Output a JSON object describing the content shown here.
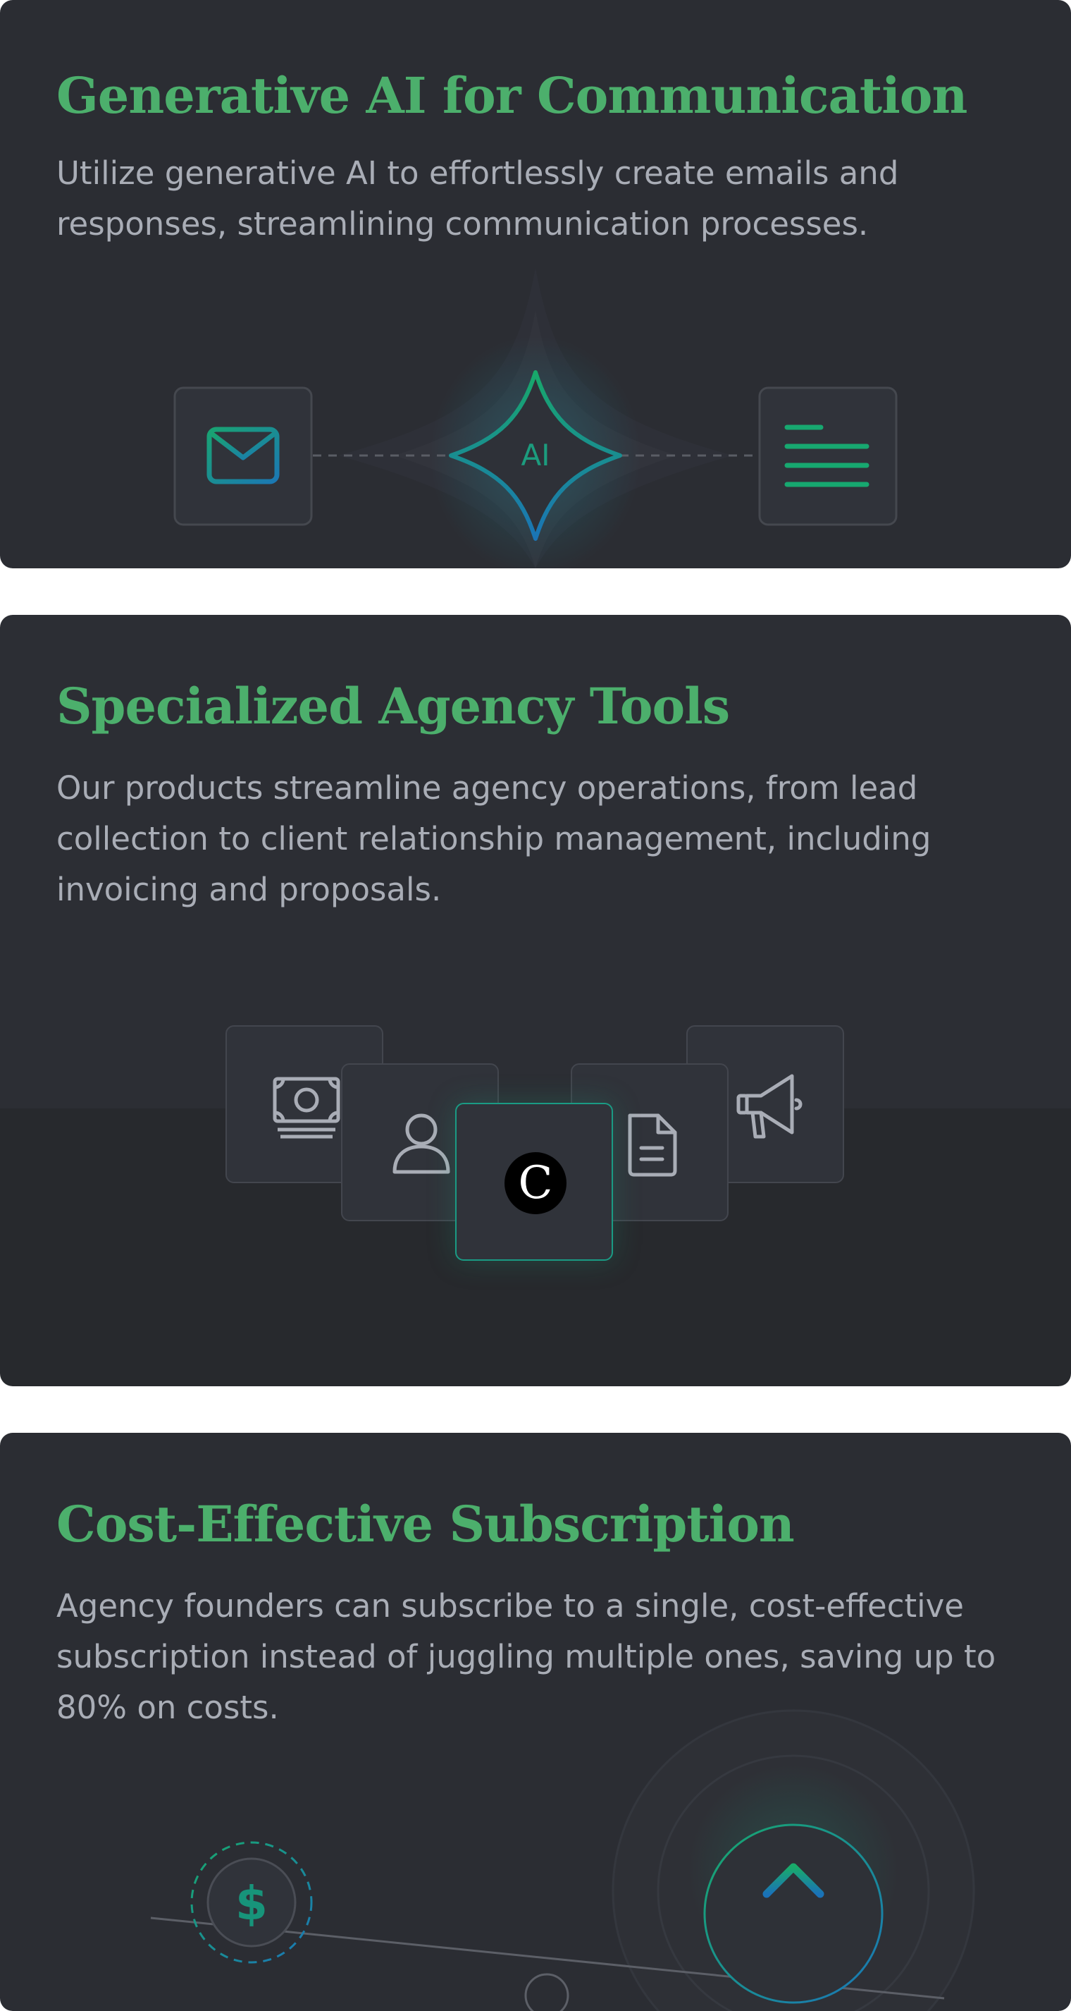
{
  "cards": [
    {
      "title": "Generative AI for Communication",
      "description": "Utilize generative AI to effortlessly create emails and responses, streamlining communication processes.",
      "illustration": {
        "left_icon": "mail-icon",
        "center_label": "AI",
        "right_icon": "text-lines-icon"
      }
    },
    {
      "title": "Specialized Agency Tools",
      "description": "Our products streamline agency operations, from lead collection to client relationship management, including invoicing and proposals.",
      "illustration": {
        "icons": [
          "money-icon",
          "user-icon",
          "logo-icon",
          "document-icon",
          "megaphone-icon"
        ],
        "logo_letter": "C"
      }
    },
    {
      "title": "Cost-Effective Subscription",
      "description": "Agency founders can subscribe to a single, cost-effective subscription instead of juggling multiple ones, saving up to 80% on costs.",
      "illustration": {
        "coin_symbol": "$",
        "right_icon": "arrow-up-icon"
      }
    }
  ],
  "colors": {
    "card_background": "#2b2d33",
    "title_green": "#4caf6c",
    "body_text": "#a9adb6",
    "accent_teal": "#18a07a",
    "accent_blue": "#1a7fb0"
  }
}
